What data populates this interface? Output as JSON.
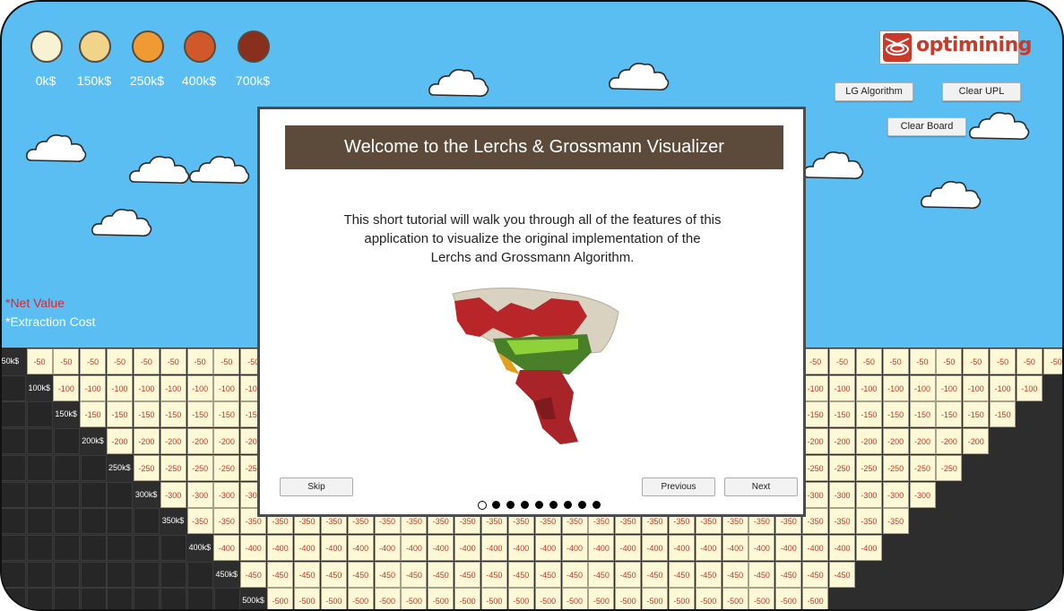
{
  "legend": [
    {
      "label": "0k$",
      "color": "#f7f2d2"
    },
    {
      "label": "150k$",
      "color": "#efd48a"
    },
    {
      "label": "250k$",
      "color": "#f09a33"
    },
    {
      "label": "400k$",
      "color": "#d1582a"
    },
    {
      "label": "700k$",
      "color": "#8a2e1d"
    }
  ],
  "notes": {
    "net_value": "*Net Value",
    "extraction_cost": "*Extraction Cost",
    "net_color": "#e8202a",
    "cost_color": "#ffffff"
  },
  "brand": {
    "name": "optimining",
    "accent": "#d8412e"
  },
  "toolbar": {
    "lg": "LG Algorithm",
    "clear_upl": "Clear UPL",
    "clear_board": "Clear Board"
  },
  "grid": {
    "rows": [
      {
        "label": "50k$",
        "value": "-50"
      },
      {
        "label": "100k$",
        "value": "-100"
      },
      {
        "label": "150k$",
        "value": "-150"
      },
      {
        "label": "200k$",
        "value": "-200"
      },
      {
        "label": "250k$",
        "value": "-250"
      },
      {
        "label": "300k$",
        "value": "-300"
      },
      {
        "label": "350k$",
        "value": "-350"
      },
      {
        "label": "400k$",
        "value": "-400"
      },
      {
        "label": "450k$",
        "value": "-450"
      },
      {
        "label": "500k$",
        "value": "-500"
      }
    ]
  },
  "modal": {
    "title": "Welcome to the Lerchs & Grossmann Visualizer",
    "body_line1": "This short tutorial will walk you through all of the features of this",
    "body_line2": "application to visualize the original implementation of the",
    "body_line3": "Lerchs and Grossmann Algorithm.",
    "skip": "Skip",
    "previous": "Previous",
    "next": "Next",
    "page_count": 9,
    "current_page": 1
  }
}
